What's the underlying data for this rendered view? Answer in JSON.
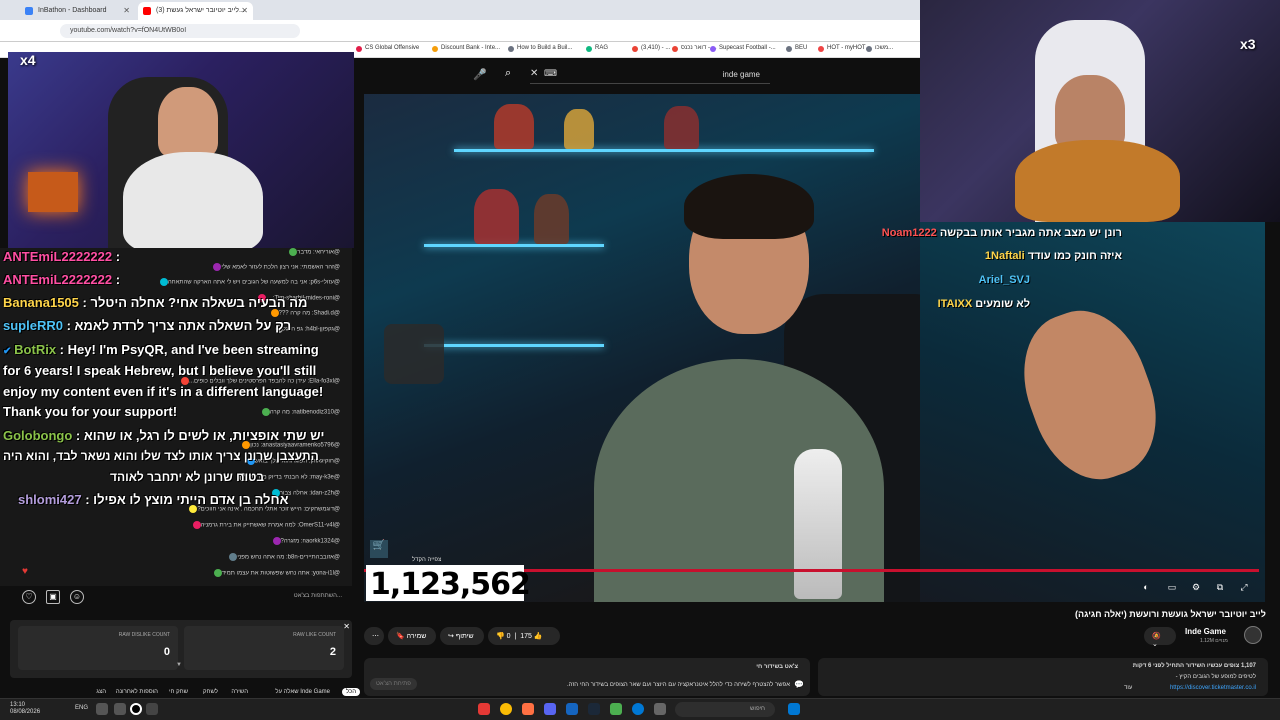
{
  "browser": {
    "tabs": [
      {
        "label": "InBathon - Dashboard",
        "color": "#3b82f6"
      },
      {
        "label": "(3) לייב יוטיובר ישראל געשת...",
        "color": "#ff0000"
      }
    ],
    "url": "youtube.com/watch?v=fON4UtWB0oI",
    "bookmarks": [
      {
        "label": "CS Global Offensive",
        "color": "#e11d48"
      },
      {
        "label": "Discount Bank - Inte...",
        "color": "#f59e0b"
      },
      {
        "label": "How to Build a Buil...",
        "color": "#6b7280"
      },
      {
        "label": "RAG",
        "color": "#10b981"
      },
      {
        "label": "(3,410) - ...",
        "color": "#ea4335"
      },
      {
        "label": "דואר נכנס - ...",
        "color": "#ea4335"
      },
      {
        "label": "Supecast Football -...",
        "color": "#8b5cf6"
      },
      {
        "label": "BEU",
        "color": "#6b7280"
      },
      {
        "label": "HOT - myHOT",
        "color": "#ef4444"
      },
      {
        "label": "משכו...",
        "color": "#6b7280"
      }
    ]
  },
  "yt": {
    "search_query": "inde game",
    "view_counter": "1,123,562",
    "view_counter_label": "צפייה הקדל",
    "video_title": "לייב יוטיובר ישראל גועשת ורועשת (יאלה חגיגה)",
    "channel_name": "Inde Game",
    "channel_subs": "1.12M מנויים",
    "like_count": "175",
    "dislike_count": "0",
    "share_label": "שיתוף",
    "save_label": "שמירה",
    "desc_left_1": "צ'אט בשידור חי",
    "desc_left_2": "אפשר להצטרף לשיחה כדי להלל איטנראקציה עם היוצר ועם שאר הצופים בשידור החי הזה.",
    "desc_left_btn": "פתיחת הצ'אט",
    "desc_right_1": "1,107 צופים עכשיו השידור התחיל לפני 6 דקות",
    "desc_right_2": "לטיפים למופע של הגובים הקיץ -",
    "desc_right_link": "https://discover.ticketmaster.co.il",
    "desc_right_more": "עוד"
  },
  "overlays": {
    "left_multiplier": "x4",
    "right_multiplier": "x3"
  },
  "chat_left": {
    "big_messages": [
      {
        "nick": "ANTEmiL2222222",
        "text": " : ",
        "color": "#ff4fa3"
      },
      {
        "nick": "ANTEmiL2222222",
        "text": " : ",
        "color": "#ff4fa3"
      },
      {
        "nick": "Banana1505",
        "text": " : מה הבעיה בשאלה אחי? אחלה היטלר",
        "color": "#ffd54a"
      },
      {
        "nick": "supleRR0",
        "text": " : רק על השאלה אתה צריך לרדת לאמא",
        "color": "#4fc3f7"
      },
      {
        "nick": "BotRix",
        "text": " : Hey! I'm PsyQR, and I've been streaming",
        "color": "#8bc34a"
      },
      {
        "nick": "",
        "text": "for 6 years! I speak Hebrew, but I believe you'll still",
        "color": "#fff"
      },
      {
        "nick": "",
        "text": "enjoy my content even if it's in a different language!",
        "color": "#fff"
      },
      {
        "nick": "",
        "text": "Thank you for your support!",
        "color": "#fff"
      },
      {
        "nick": "Golobongo",
        "text": " : יש שתי אופציות, או לשים לו רגל, או שהוא",
        "color": "#8bc34a"
      },
      {
        "nick": "",
        "text": "התעצבן שרונן צריך אותו לצד שלו והוא נשאר לבד, והוא היה",
        "color": "#fff"
      },
      {
        "nick": "",
        "text": "בטוח שרונן לא יתחבר לאוהד",
        "color": "#fff"
      },
      {
        "nick": "shlomi427",
        "text": " : אחלה בן אדם הייתי מוצץ לו אפילו",
        "color": "#b39ddb"
      }
    ],
    "small_messages": [
      {
        "text": "@אוריחאי: מדבר",
        "color": "#4caf50"
      },
      {
        "text": "@זהר האשמתי: אני רצון הלכת לעזור לאמא שלי",
        "color": "#9c27b0"
      },
      {
        "text": "@עזולי-p6s: אני בה למשעה של הגובים ויש לי אתה הארקה שהתאחה",
        "color": "#00bcd4"
      },
      {
        "text": "@Tim-sharbil-mides-roni: ...",
        "color": "#e91e63"
      },
      {
        "text": "@Shadi.d: מה קרה ???",
        "color": "#ff9800"
      },
      {
        "text": "@גקפוןן-h4bl: גפ הרגל",
        "color": "#9e9e9e"
      },
      {
        "text": "@Ella-fo3xl: עידן כה להבפד הפרסטינים שלך וובלים כופים...",
        "color": "#f44336"
      },
      {
        "text": "@natibenodiz310: מה קרה",
        "color": "#4caf50"
      },
      {
        "text": "@anastasiyaavramenko5796: נכון",
        "color": "#ff9800"
      },
      {
        "text": "@חוקיגאווק: הפוגרוהוא שלך בואש",
        "color": "#2196f3"
      },
      {
        "text": "@may-k3e: לא הבנתי בדיוק מה קרה",
        "color": "#9e9e9e"
      },
      {
        "text": "@idan-z2h: אחלה צבור",
        "color": "#00bcd4"
      },
      {
        "text": "@דוגמשחקים: הייש זוכר אתלי תחכמה : אינה אני חווכים?",
        "color": "#ffeb3b"
      },
      {
        "text": "@OmerS11-v4l: למה אמרת שאשתייק את בירת גרמניה",
        "color": "#e91e63"
      },
      {
        "text": "@naorkk1324: מזגרה?",
        "color": "#9c27b0"
      },
      {
        "text": "@אזובבהתיירים-b8n: מה אתה נחש מפני",
        "color": "#607d8b"
      },
      {
        "text": "@yona-i1l: אתה נחש שפשוטות את עצמו תמיד",
        "color": "#4caf50"
      }
    ],
    "input_placeholder": "השתתפות בצ'אט...",
    "raw_dislike_label": "RAW DISLIKE COUNT",
    "raw_dislike_value": "0",
    "raw_like_label": "RAW LIKE COUNT",
    "raw_like_value": "2",
    "bottom_tabs": [
      "הכל",
      "שאלה על Inde Game",
      "השירה",
      "לשחק",
      "שחק חי",
      "הוספות לאחרונה",
      "הצג"
    ]
  },
  "chat_right": [
    {
      "nick": "Noam1222",
      "text": "רונן יש מצב אתה מגביר אותו בבקשה",
      "color": "#ff5252"
    },
    {
      "nick": "1Naftali",
      "text": "איזה חונק כמו עודד",
      "color": "#ffd54a"
    },
    {
      "nick": "Ariel_SVJ",
      "text": "",
      "color": "#4fc3f7"
    },
    {
      "nick": "ITAIXX",
      "text": "לא שומעים",
      "color": "#ffd54a"
    }
  ],
  "taskbar": {
    "time": "13:10",
    "date": "08/08/2026",
    "lang": "ENG",
    "search_placeholder": "חיפוש"
  }
}
